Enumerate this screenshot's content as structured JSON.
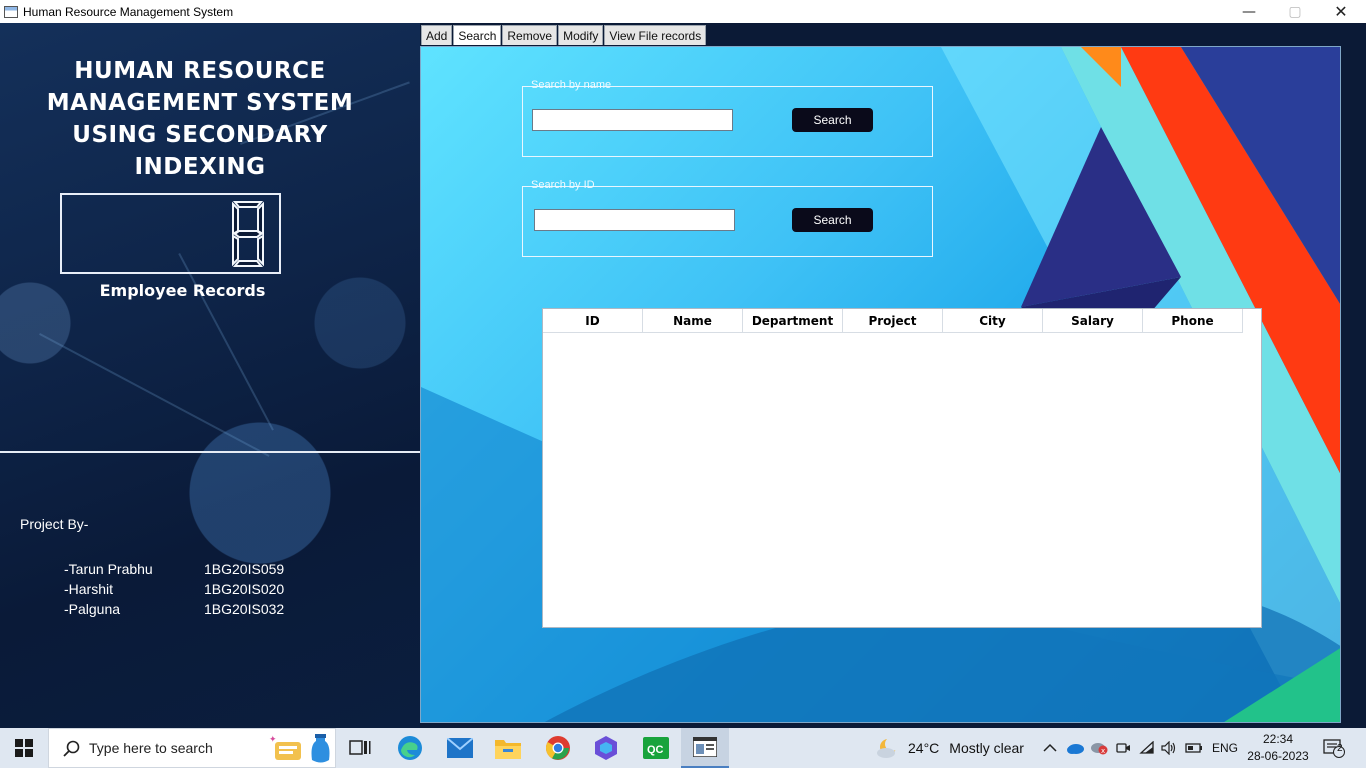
{
  "window": {
    "title": "Human Resource Management System",
    "controls": {
      "minimize": "—",
      "maximize": "▢",
      "close": "✕"
    }
  },
  "sidebar": {
    "title_line1": "HUMAN RESOURCE",
    "title_line2": "MANAGEMENT SYSTEM",
    "title_line3": "USING SECONDARY INDEXING",
    "record_count": 8,
    "records_label": "Employee Records",
    "project_by": "Project By-",
    "members": [
      {
        "name": "-Tarun Prabhu",
        "usn": "1BG20IS059"
      },
      {
        "name": "-Harshit",
        "usn": "1BG20IS020"
      },
      {
        "name": "-Palguna",
        "usn": "1BG20IS032"
      }
    ]
  },
  "tabs": [
    {
      "label": "Add"
    },
    {
      "label": "Search",
      "active": true
    },
    {
      "label": "Remove"
    },
    {
      "label": "Modify"
    },
    {
      "label": "View File records"
    }
  ],
  "search_by_name": {
    "legend": "Search by name",
    "value": "",
    "button": "Search"
  },
  "search_by_id": {
    "legend": "Search by ID",
    "value": "",
    "button": "Search"
  },
  "results_table": {
    "columns": [
      "ID",
      "Name",
      "Department",
      "Project",
      "City",
      "Salary",
      "Phone"
    ],
    "rows": []
  },
  "taskbar": {
    "search_placeholder": "Type here to search",
    "weather_temp": "24°C",
    "weather_text": "Mostly clear",
    "language": "ENG",
    "time": "22:34",
    "date": "28-06-2023",
    "notification_count": "2",
    "apps": [
      "task-view-icon",
      "edge-icon",
      "mail-icon",
      "file-explorer-icon",
      "chrome-icon",
      "copilot-icon",
      "qc-icon",
      "hrms-app-icon"
    ]
  },
  "colors": {
    "left_panel": "#0e2448",
    "button_bg": "#0a0a1a",
    "right_panel": "#3fc2f6",
    "taskbar": "#dfe7f1"
  }
}
